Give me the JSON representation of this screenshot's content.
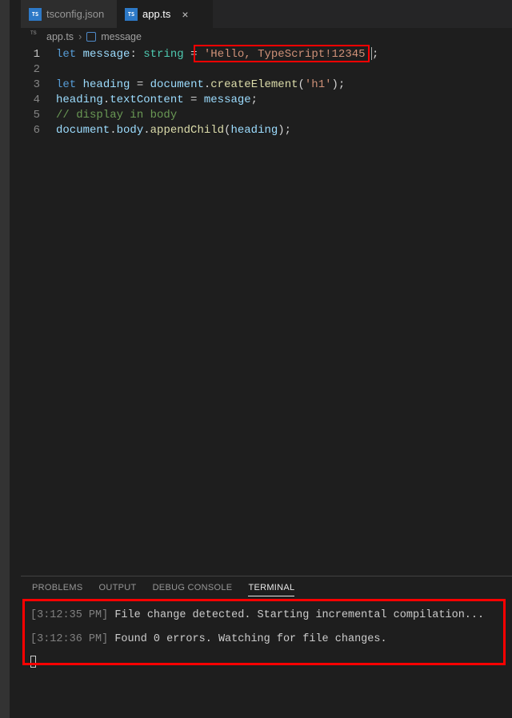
{
  "tabs": [
    {
      "icon": "TS",
      "label": "tsconfig.json",
      "active": false
    },
    {
      "icon": "TS",
      "label": "app.ts",
      "active": true
    }
  ],
  "breadcrumb": {
    "file_icon": "TS",
    "file": "app.ts",
    "sep": "›",
    "symbol": "message"
  },
  "code": {
    "l1_let": "let",
    "l1_msg": " message",
    "l1_colon": ": ",
    "l1_type": "string",
    "l1_eq": " = ",
    "l1_str": "'Hello, TypeScript!12345'",
    "l1_semi": ";",
    "l3_let": "let",
    "l3_head": " heading ",
    "l3_eq": "= ",
    "l3_doc": "document",
    "l3_dot1": ".",
    "l3_fn": "createElement",
    "l3_open": "(",
    "l3_arg": "'h1'",
    "l3_close": ");",
    "l4_head": "heading",
    "l4_dot": ".",
    "l4_prop": "textContent",
    "l4_eq": " = ",
    "l4_msg": "message",
    "l4_semi": ";",
    "l5_comment": "// display in body",
    "l6_doc": "document",
    "l6_d1": ".",
    "l6_body": "body",
    "l6_d2": ".",
    "l6_fn": "appendChild",
    "l6_open": "(",
    "l6_arg": "heading",
    "l6_close": ");"
  },
  "panel_tabs": {
    "problems": "PROBLEMS",
    "output": "OUTPUT",
    "debug": "DEBUG CONSOLE",
    "terminal": "TERMINAL"
  },
  "terminal": {
    "line1_time": "[3:12:35 PM]",
    "line1_msg": " File change detected. Starting incremental compilation...",
    "line2_time": "[3:12:36 PM]",
    "line2_msg": " Found 0 errors. Watching for file changes."
  }
}
